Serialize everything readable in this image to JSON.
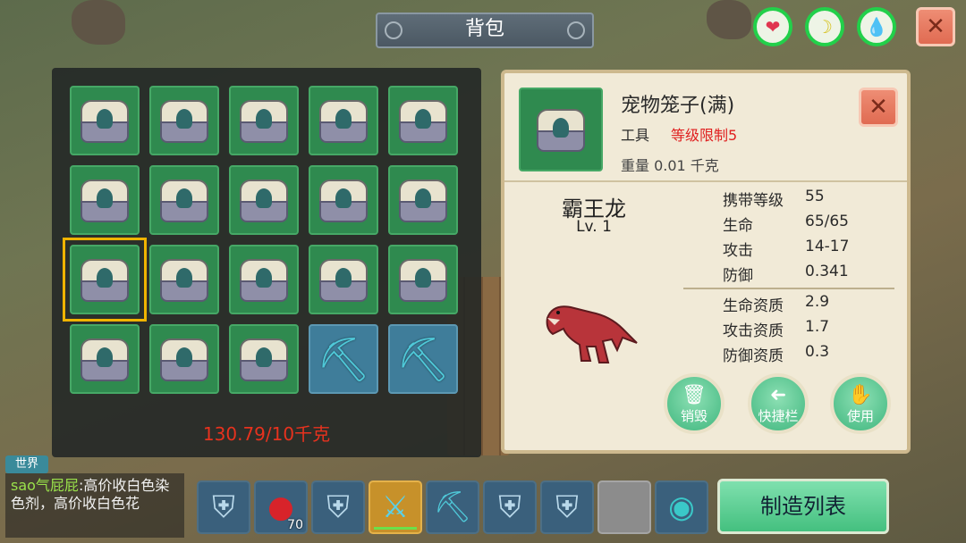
{
  "title": "背包",
  "status_icons": [
    {
      "name": "heart-icon",
      "glyph": "❤",
      "color": "#e0354f"
    },
    {
      "name": "banana-icon",
      "glyph": "☽",
      "color": "#d6c21d"
    },
    {
      "name": "water-drop-icon",
      "glyph": "💧",
      "color": "#1fa3d6"
    }
  ],
  "close_glyph": "✕",
  "inventory": {
    "rows": [
      [
        "cage",
        "cage",
        "cage",
        "cage",
        "cage"
      ],
      [
        "cage",
        "cage",
        "cage",
        "cage",
        "cage"
      ],
      [
        "cage",
        "cage",
        "cage",
        "cage",
        "cage"
      ],
      [
        "cage",
        "cage",
        "cage",
        "pickaxe",
        "pickaxe"
      ]
    ],
    "selected": {
      "row": 2,
      "col": 0
    },
    "weight": "130.79/10千克"
  },
  "detail": {
    "name": "宠物笼子(满)",
    "type": "工具",
    "level_limit": "等级限制5",
    "weight": "重量  0.01 千克",
    "pet_name": "霸王龙",
    "pet_level": "Lv. 1",
    "stats": [
      {
        "label": "携带等级",
        "value": "55"
      },
      {
        "label": "生命",
        "value": "65/65"
      },
      {
        "label": "攻击",
        "value": "14-17"
      },
      {
        "label": "防御",
        "value": "0.341"
      }
    ],
    "aptitudes": [
      {
        "label": "生命资质",
        "value": "2.9"
      },
      {
        "label": "攻击资质",
        "value": "1.7"
      },
      {
        "label": "防御资质",
        "value": "0.3"
      }
    ],
    "actions": [
      {
        "label": "销毁",
        "icon": "trash-icon",
        "glyph": "🗑"
      },
      {
        "label": "快捷栏",
        "icon": "arrow-left-icon",
        "glyph": "➜"
      },
      {
        "label": "使用",
        "icon": "hand-icon",
        "glyph": "✋"
      }
    ]
  },
  "chat": {
    "channel": "世界",
    "user": "sao气屁屁",
    "message": ":高价收白色染色剂，高价收白色花"
  },
  "hotbar": [
    {
      "item": "armor-icon",
      "glyph": "⛨"
    },
    {
      "item": "red-dye-icon",
      "glyph": "●",
      "count": "70"
    },
    {
      "item": "armor-icon",
      "glyph": "⛨"
    },
    {
      "item": "sword-icon",
      "glyph": "⚔"
    },
    {
      "item": "pickaxe-icon",
      "glyph": "⛏"
    },
    {
      "item": "armor-icon",
      "glyph": "⛨"
    },
    {
      "item": "armor-icon",
      "glyph": "⛨"
    },
    {
      "item": "empty-slot",
      "glyph": ""
    },
    {
      "item": "orb-icon",
      "glyph": "◉"
    }
  ],
  "craft_button": "制造列表"
}
